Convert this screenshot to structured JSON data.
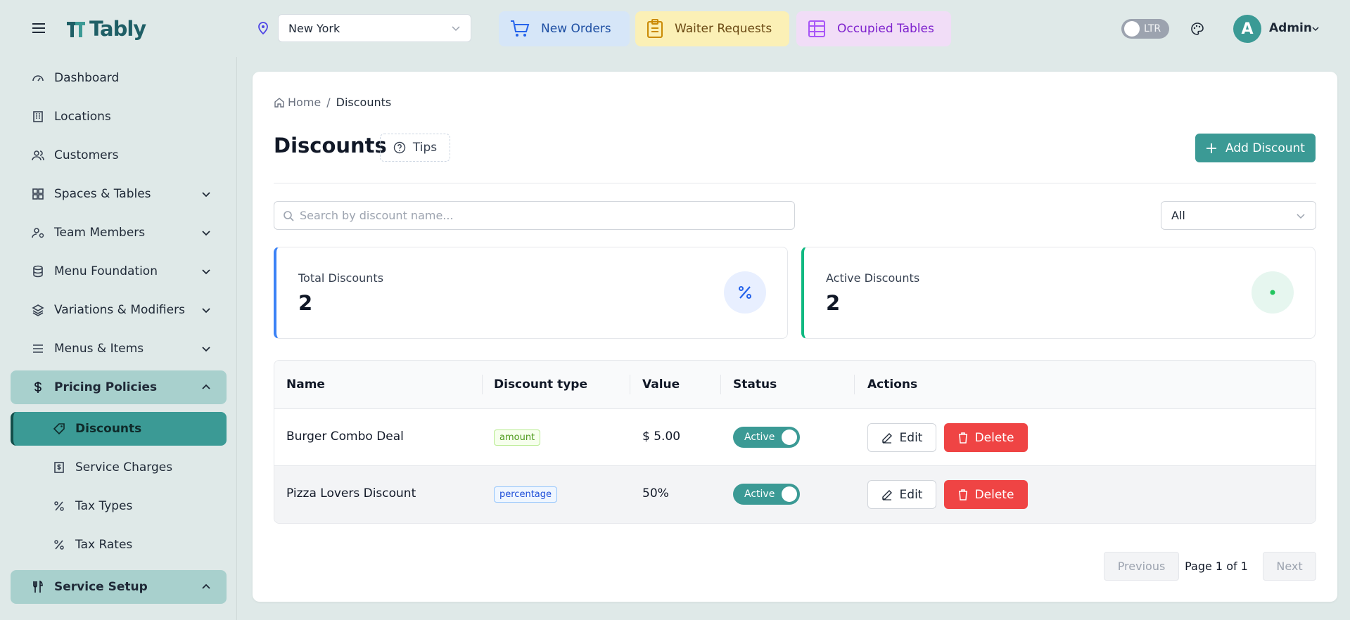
{
  "app": {
    "name": "Tably"
  },
  "header": {
    "location": {
      "selected": "New York"
    },
    "quick_actions": [
      {
        "label": "New Orders",
        "color": "#1e4fa3"
      },
      {
        "label": "Waiter Requests",
        "color": "#6b4a14"
      },
      {
        "label": "Occupied Tables",
        "color": "#7e22ce"
      }
    ],
    "direction_toggle": "LTR",
    "user": {
      "initial": "A",
      "name": "Admin"
    }
  },
  "sidebar": {
    "items": [
      {
        "label": "Dashboard",
        "icon": "gauge-icon"
      },
      {
        "label": "Locations",
        "icon": "building-icon"
      },
      {
        "label": "Customers",
        "icon": "users-icon"
      },
      {
        "label": "Spaces & Tables",
        "icon": "grid-icon"
      },
      {
        "label": "Team Members",
        "icon": "user-gear-icon"
      },
      {
        "label": "Menu Foundation",
        "icon": "database-icon"
      },
      {
        "label": "Variations & Modifiers",
        "icon": "layers-icon"
      },
      {
        "label": "Menus & Items",
        "icon": "list-icon"
      },
      {
        "label": "Pricing Policies",
        "icon": "dollar-icon"
      },
      {
        "label": "Service Setup",
        "icon": "utensils-icon"
      }
    ],
    "pricing_sub": [
      {
        "label": "Discounts",
        "icon": "discount-tag-icon"
      },
      {
        "label": "Service Charges",
        "icon": "receipt-icon"
      },
      {
        "label": "Tax Types",
        "icon": "percent-icon"
      },
      {
        "label": "Tax Rates",
        "icon": "percent-icon"
      }
    ]
  },
  "breadcrumb": {
    "home": "Home",
    "separator": "/",
    "current": "Discounts"
  },
  "page": {
    "title": "Discounts",
    "tips": "Tips",
    "add_button": "Add Discount"
  },
  "search": {
    "placeholder": "Search by discount name...",
    "value": ""
  },
  "filter": {
    "selected": "All"
  },
  "stats": [
    {
      "label": "Total Discounts",
      "value": "2",
      "accent": "#3b82f6"
    },
    {
      "label": "Active Discounts",
      "value": "2",
      "accent": "#10b981"
    }
  ],
  "table": {
    "columns": [
      "Name",
      "Discount type",
      "Value",
      "Status",
      "Actions"
    ],
    "rows": [
      {
        "name": "Burger Combo Deal",
        "type": "amount",
        "value": "$ 5.00",
        "status": "Active"
      },
      {
        "name": "Pizza Lovers Discount",
        "type": "percentage",
        "value": "50%",
        "status": "Active"
      }
    ],
    "edit_label": "Edit",
    "delete_label": "Delete"
  },
  "pagination": {
    "previous": "Previous",
    "info": "Page 1 of 1",
    "next": "Next"
  },
  "colors": {
    "brand": "#3b9a95",
    "danger": "#ef4444",
    "sidebar_bg": "#dfe9e8"
  }
}
